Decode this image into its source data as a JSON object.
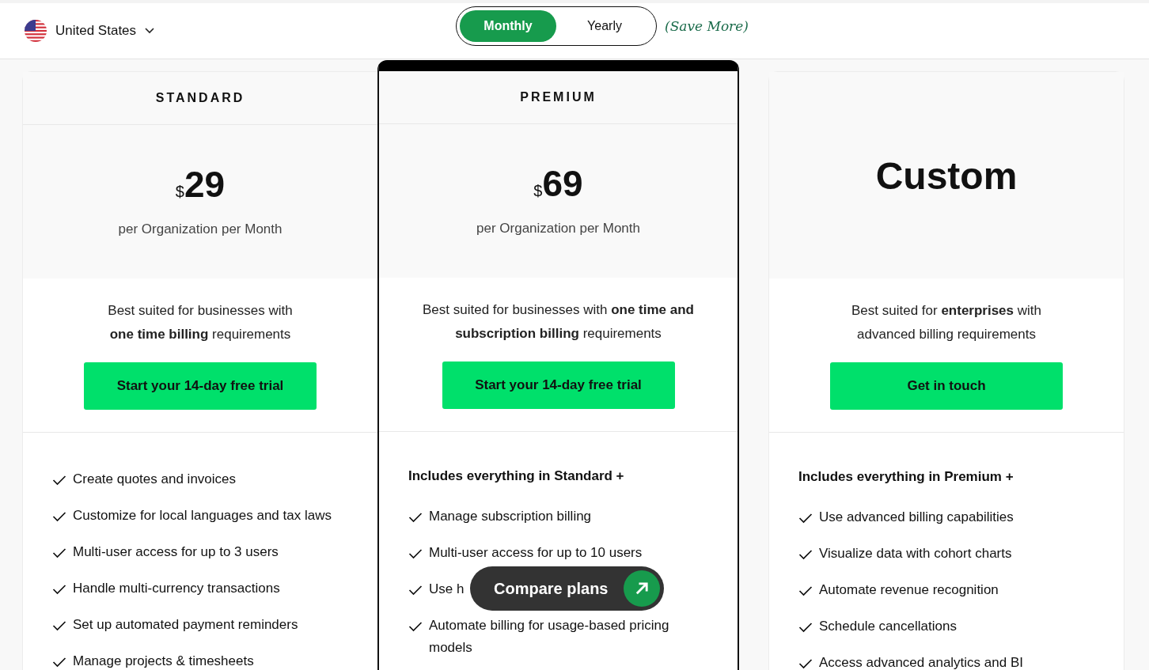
{
  "header": {
    "country": "United States",
    "billing_toggle": [
      {
        "label": "Monthly",
        "selected": true
      },
      {
        "label": "Yearly",
        "selected": false
      }
    ],
    "save_note": "(Save More)"
  },
  "plans": [
    {
      "kind": "priced",
      "name": "STANDARD",
      "highlighted": false,
      "currency": "$",
      "price": "29",
      "period": "per Organization per Month",
      "description_lines": [
        "Best suited for businesses with",
        "**one time billing** requirements"
      ],
      "button": "Start your 14-day free trial",
      "features": [
        "Create quotes and invoices",
        "Customize for local languages and tax laws",
        "Multi-user access for up to 3 users",
        "Handle multi-currency transactions",
        "Set up automated payment reminders",
        "Manage projects & timesheets"
      ]
    },
    {
      "kind": "priced",
      "name": "PREMIUM",
      "highlighted": true,
      "currency": "$",
      "price": "69",
      "period": "per Organization per Month",
      "description_lines": [
        "Best suited for businesses with **one time and**",
        "**subscription billing** requirements"
      ],
      "button": "Start your 14-day free trial",
      "features_heading": "Includes everything in Standard +",
      "features": [
        "Manage subscription billing",
        "Multi-user access for up to 10 users",
        "Use h",
        "Automate billing for usage-based pricing models"
      ]
    },
    {
      "kind": "custom",
      "price": "Custom",
      "highlighted": false,
      "description_lines": [
        "Best suited for **enterprises** with",
        "advanced billing requirements"
      ],
      "button": "Get in touch",
      "features_heading": "Includes everything in Premium +",
      "features": [
        "Use advanced billing capabilities",
        "Visualize data with cohort charts",
        "Automate revenue recognition",
        "Schedule cancellations",
        "Access advanced analytics and BI"
      ]
    }
  ],
  "compare_button": "Compare plans"
}
